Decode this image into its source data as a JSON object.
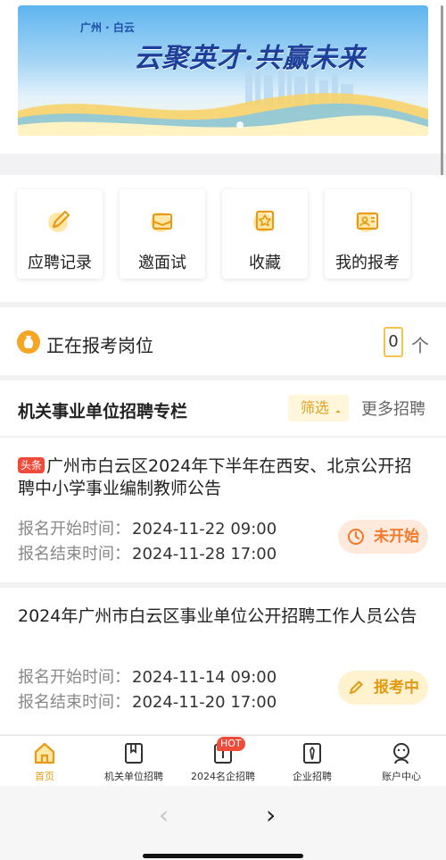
{
  "banner": {
    "tag": "广州 · 白云",
    "slogan": "云聚英才·共赢未来"
  },
  "quick_actions": [
    {
      "label": "应聘记录",
      "icon": "pencil-icon"
    },
    {
      "label": "邀面试",
      "icon": "envelope-icon"
    },
    {
      "label": "收藏",
      "icon": "star-box-icon"
    },
    {
      "label": "我的报考",
      "icon": "id-card-icon"
    }
  ],
  "applying": {
    "title": "正在报考岗位",
    "count": "0",
    "unit": "个"
  },
  "column": {
    "title": "机关事业单位招聘专栏",
    "filter_label": "筛选",
    "more_label": "更多招聘"
  },
  "cards": [
    {
      "badge": "头条",
      "title": "广州市白云区2024年下半年在西安、北京公开招聘中小学事业编制教师公告",
      "start_label": "报名开始时间：",
      "start_value": "2024-11-22 09:00",
      "end_label": "报名结束时间：",
      "end_value": "2024-11-28 17:00",
      "status": "未开始",
      "status_color": "#f07a2a",
      "status_bg": "#ffe9dc"
    },
    {
      "badge": "",
      "title": "2024年广州市白云区事业单位公开招聘工作人员公告",
      "start_label": "报名开始时间：",
      "start_value": "2024-11-14 09:00",
      "end_label": "报名结束时间：",
      "end_value": "2024-11-20 17:00",
      "status": "报考中",
      "status_color": "#e39a10",
      "status_bg": "#fff2cf"
    }
  ],
  "tabbar": {
    "tabs": [
      {
        "label": "首页",
        "icon": "home-icon",
        "active": true
      },
      {
        "label": "机关单位招聘",
        "icon": "book-icon",
        "active": false
      },
      {
        "label": "2024名企招聘",
        "icon": "briefcase-icon",
        "active": false
      },
      {
        "label": "企业招聘",
        "icon": "tie-icon",
        "active": false
      },
      {
        "label": "账户中心",
        "icon": "user-icon",
        "active": false
      }
    ],
    "hot_badge": "HOT"
  },
  "browser": {
    "back_glyph": "‹",
    "forward_glyph": "›"
  },
  "colors": {
    "accent": "#f5a623",
    "active_tab": "#e89a12",
    "badge_red": "#f04a3a"
  }
}
